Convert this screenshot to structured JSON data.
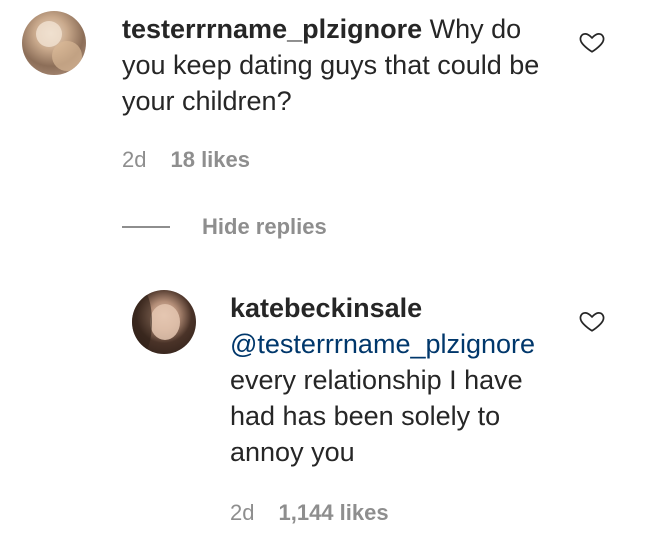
{
  "comment": {
    "username": "testerrrname_plzignore",
    "text": "Why do you keep dating guys that could be your children?",
    "time": "2d",
    "likes": "18 likes"
  },
  "replies_toggle": {
    "label": "Hide replies"
  },
  "reply": {
    "username": "katebeckinsale",
    "mention": "@testerrrname_plzignore",
    "text": "every relationship I have had has been solely to annoy you",
    "time": "2d",
    "likes": "1,144 likes"
  },
  "icons": {
    "like": "heart-outline-icon"
  },
  "colors": {
    "text": "#262626",
    "muted": "#8e8e8e",
    "mention": "#00376b"
  }
}
